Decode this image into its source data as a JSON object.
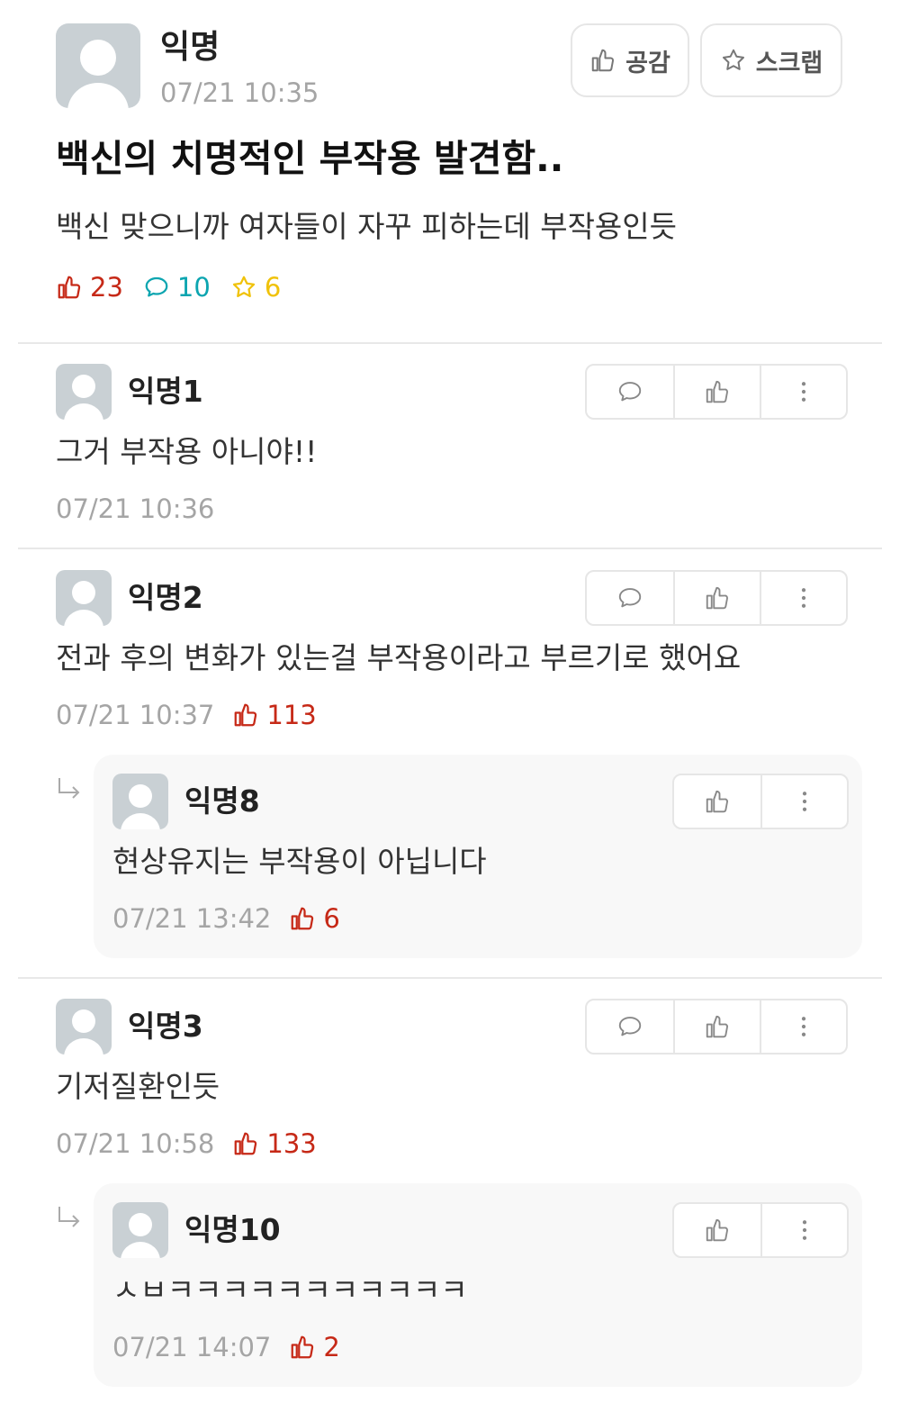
{
  "post": {
    "author": "익명",
    "time": "07/21 10:35",
    "like_button_label": "공감",
    "scrap_button_label": "스크랩",
    "title": "백신의 치명적인 부작용 발견함..",
    "body": "백신 맞으니까 여자들이 자꾸 피하는데 부작용인듯",
    "vote_count": "23",
    "comment_count": "10",
    "scrap_count": "6"
  },
  "comments": [
    {
      "author": "익명1",
      "text": "그거 부작용 아니야!!",
      "time": "07/21 10:36",
      "votes": ""
    },
    {
      "author": "익명2",
      "text": "전과 후의 변화가 있는걸 부작용이라고 부르기로 했어요",
      "time": "07/21 10:37",
      "votes": "113"
    },
    {
      "author": "익명3",
      "text": "기저질환인듯",
      "time": "07/21 10:58",
      "votes": "133"
    }
  ],
  "replies": [
    {
      "author": "익명8",
      "text": "현상유지는 부작용이 아닙니다",
      "time": "07/21 13:42",
      "votes": "6"
    },
    {
      "author": "익명10",
      "text": "ㅅㅂㅋㅋㅋㅋㅋㅋㅋㅋㅋㅋㅋ",
      "time": "07/21 14:07",
      "votes": "2"
    }
  ],
  "colors": {
    "vote": "#c62917",
    "comment": "#0ca5b0",
    "scrap": "#f0c20a",
    "muted": "#a5a5a5",
    "avatar": "#c9d0d4"
  },
  "icons": {
    "thumb": "thumb-up-icon",
    "bubble": "comment-bubble-icon",
    "star": "star-icon",
    "dots": "more-vertical-icon",
    "reply": "reply-arrow-icon"
  }
}
